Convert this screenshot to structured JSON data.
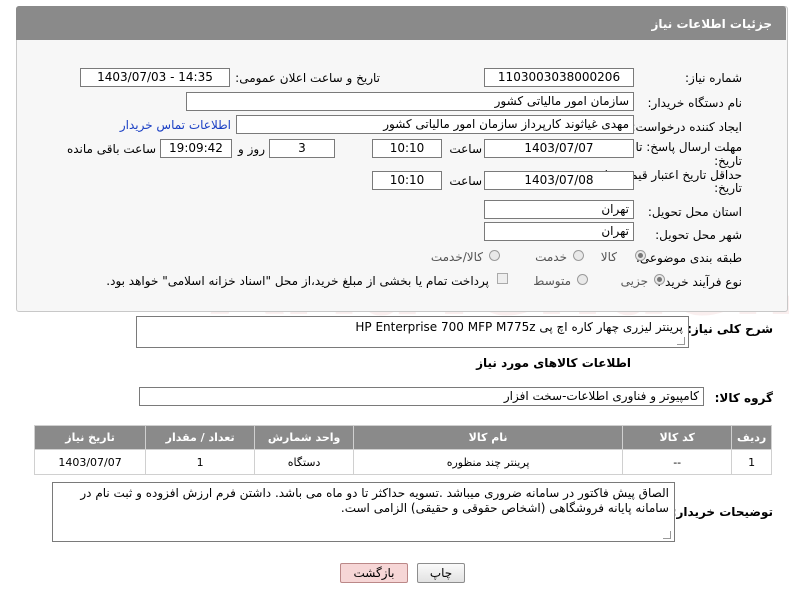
{
  "header": {
    "title": "جزئیات اطلاعات نیاز"
  },
  "fields": {
    "need_number_label": "شماره نیاز:",
    "need_number": "1103003038000206",
    "announce_label": "تاریخ و ساعت اعلان عمومی:",
    "announce_value": "1403/07/03 - 14:35",
    "buyer_org_label": "نام دستگاه خریدار:",
    "buyer_org": "سازمان امور مالیاتی کشور",
    "creator_label": "ایجاد کننده درخواست:",
    "creator": "مهدی غیاثوند کارپرداز سازمان امور مالیاتی کشور",
    "contact_link": "اطلاعات تماس خریدار",
    "deadline_label_1": "مهلت ارسال پاسخ: تا",
    "deadline_label_2": "تاریخ:",
    "deadline_date": "1403/07/07",
    "time_label": "ساعت",
    "deadline_time": "10:10",
    "days_value": "3",
    "days_label": "روز و",
    "remaining_time": "19:09:42",
    "remaining_label": "ساعت باقی مانده",
    "validity_label_1": "حداقل تاریخ اعتبار قیمت: تا",
    "validity_label_2": "تاریخ:",
    "validity_date": "1403/07/08",
    "validity_time": "10:10",
    "province_label": "استان محل تحویل:",
    "province": "تهران",
    "city_label": "شهر محل تحویل:",
    "city": "تهران",
    "category_label": "طبقه بندی موضوعی:",
    "category_options": [
      "کالا",
      "خدمت",
      "کالا/خدمت"
    ],
    "process_label": "نوع فرآیند خرید :",
    "process_options": [
      "جزیی",
      "متوسط"
    ],
    "payment_note": "پرداخت تمام یا بخشی از مبلغ خرید،از محل \"اسناد خزانه اسلامی\" خواهد بود."
  },
  "description": {
    "label": "شرح کلی نیاز:",
    "value": "پرینتر لیزری چهار کاره اچ پی HP Enterprise 700 MFP M775z"
  },
  "goods": {
    "section_title": "اطلاعات کالاهای مورد نیاز",
    "group_label": "گروه کالا:",
    "group_value": "کامپیوتر و فناوری اطلاعات-سخت افزار",
    "columns": [
      "ردیف",
      "کد کالا",
      "نام کالا",
      "واحد شمارش",
      "تعداد / مقدار",
      "تاریخ نیاز"
    ],
    "rows": [
      [
        "1",
        "--",
        "پرینتر چند منظوره",
        "دستگاه",
        "1",
        "1403/07/07"
      ]
    ]
  },
  "buyer_notes": {
    "label": "توضیحات خریدار:",
    "value": "الصاق پیش فاکتور در سامانه ضروری میباشد .تسویه حداکثر تا دو ماه می باشد.  داشتن فرم ارزش افزوده و ثبت نام در سامانه پایانه فروشگاهی (اشخاص حقوقی و حقیقی) الزامی است."
  },
  "buttons": {
    "print": "چاپ",
    "back": "بازگشت"
  },
  "watermark": "AriaTender.neT",
  "colors": {
    "header_bg": "#8a8a8a",
    "link": "#1a3fc4",
    "back_button_bg": "#f6d6d6"
  }
}
